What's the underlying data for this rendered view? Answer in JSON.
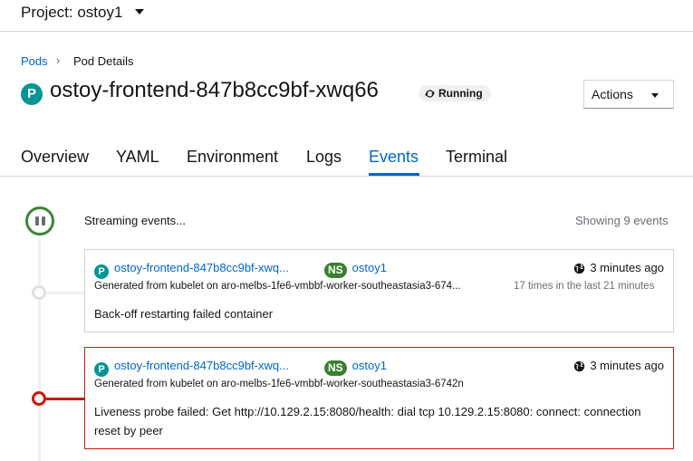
{
  "project": {
    "label": "Project: ostoy1"
  },
  "breadcrumb": {
    "pods": "Pods",
    "sep": "›",
    "current": "Pod Details"
  },
  "pod": {
    "badge": "P",
    "name": "ostoy-frontend-847b8cc9bf-xwq66",
    "status": "Running"
  },
  "actions": {
    "label": "Actions"
  },
  "tabs": [
    "Overview",
    "YAML",
    "Environment",
    "Logs",
    "Events",
    "Terminal"
  ],
  "active_tab": "Events",
  "events_header": {
    "streaming": "Streaming events...",
    "showing": "Showing 9 events"
  },
  "events": [
    {
      "resource_badge": "P",
      "resource": "ostoy-frontend-847b8cc9bf-xwq...",
      "ns_badge": "NS",
      "namespace": "ostoy1",
      "time": "3 minutes ago",
      "source": "Generated from kubelet on aro-melbs-1fe6-vmbbf-worker-southeastasia3-674...",
      "count": "17 times in the last 21 minutes",
      "message": "Back-off restarting failed container"
    },
    {
      "resource_badge": "P",
      "resource": "ostoy-frontend-847b8cc9bf-xwq...",
      "ns_badge": "NS",
      "namespace": "ostoy1",
      "time": "3 minutes ago",
      "source": "Generated from kubelet on aro-melbs-1fe6-vmbbf-worker-southeastasia3-6742n",
      "message": "Liveness probe failed: Get http://10.129.2.15:8080/health: dial tcp 10.129.2.15:8080: connect: connection reset by peer"
    }
  ],
  "icons": {
    "pause": "pause-icon",
    "sync": "sync-icon",
    "globe": "globe-icon",
    "caret": "caret-down-icon"
  },
  "colors": {
    "link": "#0066cc",
    "running_ring": "#3e8635",
    "warning": "#c9190b",
    "pod_badge": "#009596",
    "ns_badge": "#38812f"
  }
}
